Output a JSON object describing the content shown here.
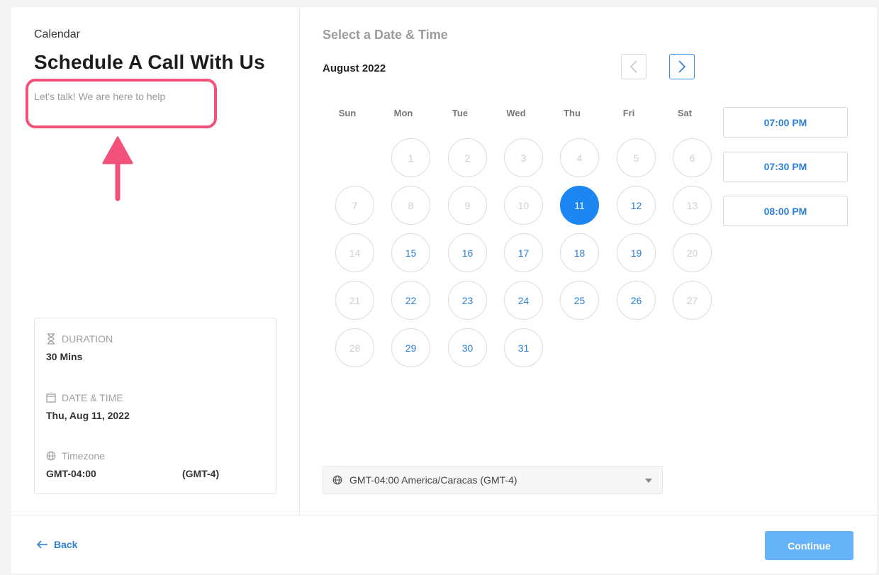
{
  "left": {
    "brand": "Calendar",
    "title": "Schedule A Call With Us",
    "description": "Let's talk! We are here to help",
    "highlight_color": "#f2527a"
  },
  "summary": {
    "duration_label": "DURATION",
    "duration_value": "30 Mins",
    "datetime_label": "DATE & TIME",
    "datetime_value": "Thu, Aug 11, 2022",
    "timezone_label": "Timezone",
    "timezone_value": "GMT-04:00",
    "timezone_offset": "(GMT-4)"
  },
  "calendar": {
    "section_title": "Select a Date & Time",
    "month": "August 2022",
    "weekdays": [
      "Sun",
      "Mon",
      "Tue",
      "Wed",
      "Thu",
      "Fri",
      "Sat"
    ],
    "first_weekday_index": 1,
    "days_in_month": 31,
    "selected_day": 11,
    "available_days": [
      12,
      15,
      16,
      17,
      18,
      19,
      22,
      23,
      24,
      25,
      26,
      29,
      30,
      31
    ],
    "accent_color": "#1c86f2"
  },
  "time_slots": [
    "07:00 PM",
    "07:30 PM",
    "08:00 PM"
  ],
  "timezone_select": {
    "value": "GMT-04:00 America/Caracas (GMT-4)"
  },
  "footer": {
    "back_label": "Back",
    "continue_label": "Continue"
  }
}
